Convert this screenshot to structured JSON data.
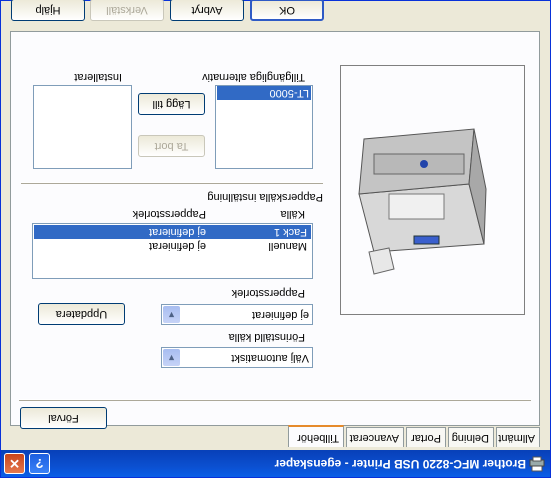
{
  "window": {
    "title": "Brother MFC-8220 USB Printer - egenskaper",
    "help_symbol": "?",
    "close_symbol": "✕"
  },
  "tabs": [
    {
      "label": "Allmänt"
    },
    {
      "label": "Delning"
    },
    {
      "label": "Portar"
    },
    {
      "label": "Avancerat"
    },
    {
      "label": "Tillbehör",
      "active": true
    }
  ],
  "options": {
    "available_label": "Tillgängliga alternativ",
    "available_items": [
      "LT-5000"
    ],
    "selected_available": "LT-5000",
    "add_button": "Lägg till",
    "remove_button": "Ta bort",
    "installed_label": "Installerat",
    "installed_items": []
  },
  "paper_source": {
    "group_label": "Papperskälla inställning",
    "col_source": "Källa",
    "col_size": "Pappersstorlek",
    "rows": [
      {
        "source": "Fack 1",
        "size": "ej definierat",
        "selected": true
      },
      {
        "source": "Manuell",
        "size": "ej definierat",
        "selected": false
      }
    ],
    "paper_size_label": "Pappersstorlek",
    "paper_size_value": "ej definierat",
    "update_button": "Uppdatera",
    "default_source_label": "Förinställd källa",
    "default_source_value": "Välj automatiskt"
  },
  "defaults_button": "Förval",
  "footer": {
    "ok": "OK",
    "cancel": "Avbryt",
    "apply": "Verkställ",
    "help": "Hjälp"
  },
  "colors": {
    "titlebar": "#0a5fe8",
    "selection": "#316ac5",
    "active_tab_accent": "#e68b2c"
  }
}
